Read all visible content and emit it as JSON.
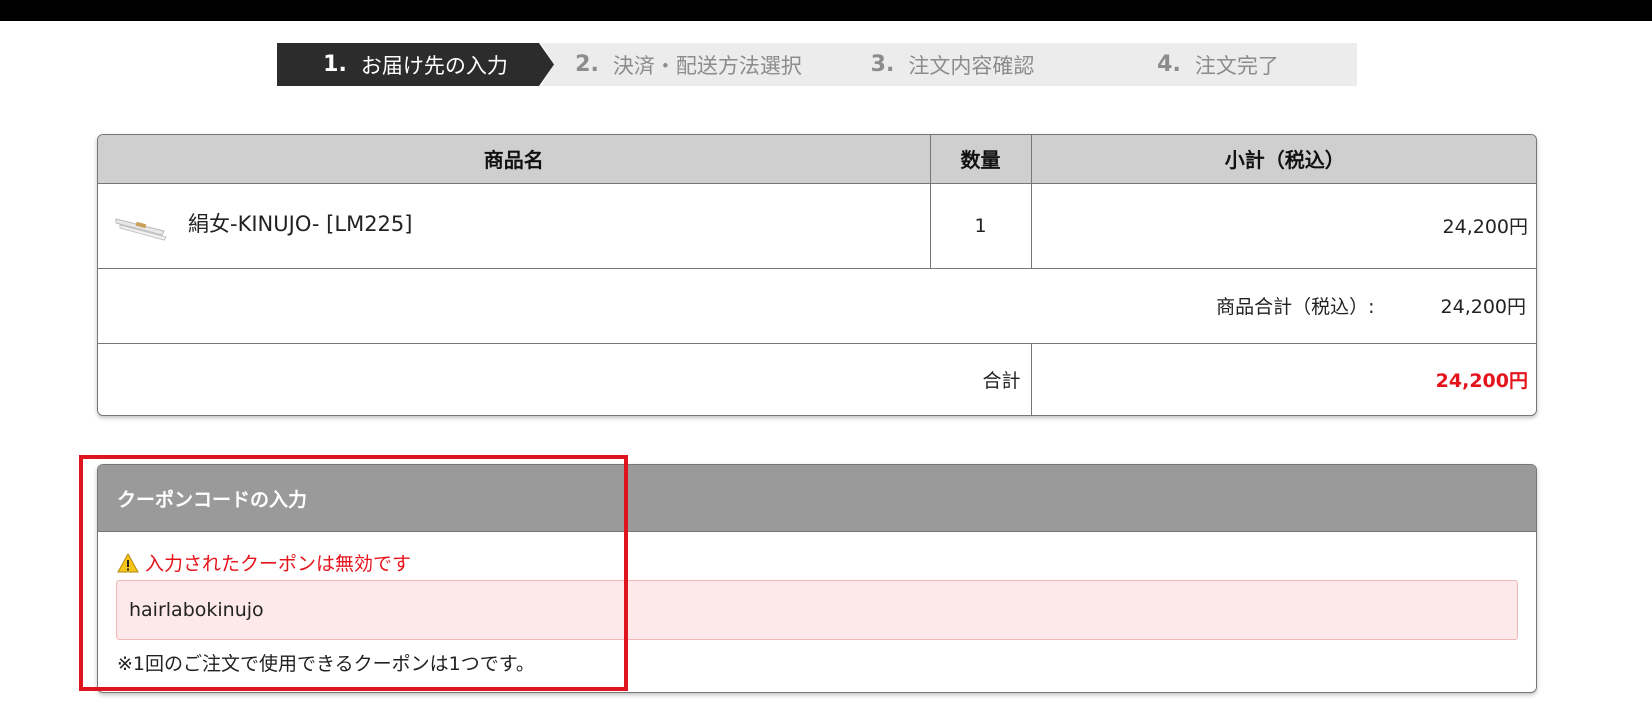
{
  "steps": [
    {
      "num": "1.",
      "label": "お届け先の入力",
      "active": true
    },
    {
      "num": "2.",
      "label": "決済・配送方法選択",
      "active": false
    },
    {
      "num": "3.",
      "label": "注文内容確認",
      "active": false
    },
    {
      "num": "4.",
      "label": "注文完了",
      "active": false
    }
  ],
  "cart": {
    "headers": {
      "product": "商品名",
      "quantity": "数量",
      "subtotal": "小計（税込）"
    },
    "items": [
      {
        "name": "絹女-KINUJO- [LM225]",
        "quantity": "1",
        "price": "24,200円",
        "thumb_icon": "hair-iron-thumbnail"
      }
    ],
    "subtotal_label": "商品合計（税込）:",
    "subtotal_value": "24,200円",
    "total_label": "合計",
    "total_value": "24,200円"
  },
  "coupon": {
    "title": "クーポンコードの入力",
    "error": "入力されたクーポンは無効です",
    "error_icon": "warning-icon",
    "input_value": "hairlabokinujo",
    "note": "※1回のご注文で使用できるクーポンは1つです。"
  },
  "colors": {
    "active_step": "#2c2c2c",
    "inactive_step": "#ececec",
    "total_red": "#e5141c",
    "highlight": "#e0141e",
    "input_error_bg": "#fde9e9"
  }
}
